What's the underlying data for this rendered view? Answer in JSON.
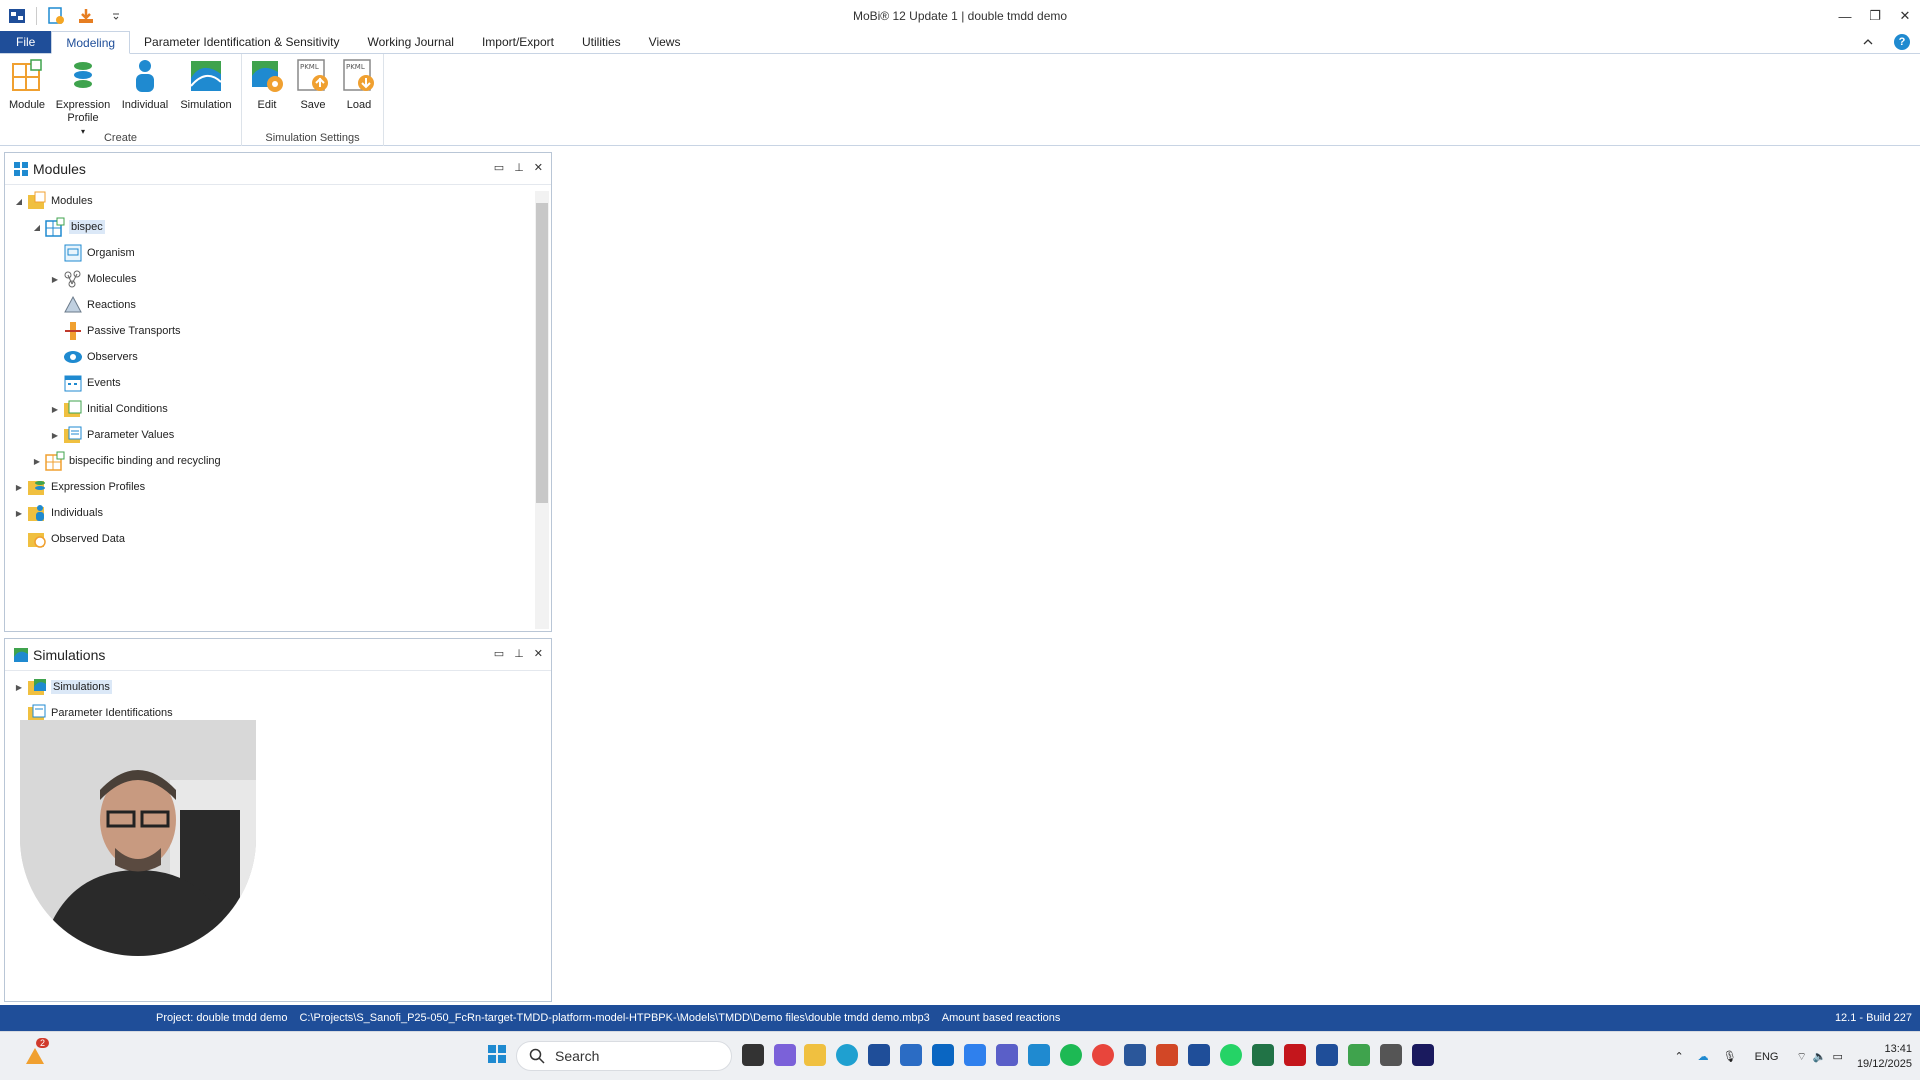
{
  "window": {
    "title": "MoBi® 12 Update 1 | double tmdd demo"
  },
  "ribbon": {
    "tabs": [
      "File",
      "Modeling",
      "Parameter Identification & Sensitivity",
      "Working Journal",
      "Import/Export",
      "Utilities",
      "Views"
    ],
    "active_tab": "Modeling",
    "create_group": {
      "label": "Create",
      "buttons": [
        "Module",
        "Expression",
        "Profile",
        "Individual",
        "Simulation"
      ]
    },
    "settings_group": {
      "label": "Simulation Settings",
      "buttons": [
        "Edit",
        "Save",
        "Load"
      ],
      "pkml_tag": "PKML"
    }
  },
  "modules_panel": {
    "title": "Modules",
    "nodes": [
      "Modules",
      "bispec",
      "Organism",
      "Molecules",
      "Reactions",
      "Passive Transports",
      "Observers",
      "Events",
      "Initial Conditions",
      "Parameter Values",
      "bispecific binding and recycling",
      "Expression Profiles",
      "Individuals",
      "Observed Data"
    ]
  },
  "simulations_panel": {
    "title": "Simulations",
    "nodes": [
      "Simulations",
      "Parameter Identifications"
    ]
  },
  "statusbar": {
    "project": "Project: double tmdd demo",
    "path": "C:\\Projects\\S_Sanofi_P25-050_FcRn-target-TMDD-platform-model-HTPBPK-\\Models\\TMDD\\Demo files\\double tmdd demo.mbp3",
    "mode": "Amount based reactions",
    "build": "12.1 - Build 227"
  },
  "taskbar": {
    "search_placeholder": "Search",
    "notification_count": "2",
    "language": "ENG",
    "time": "13:41",
    "date": "19/12/2025"
  },
  "colors": {
    "accent": "#1f4e99",
    "selection": "#dbe8f7"
  }
}
